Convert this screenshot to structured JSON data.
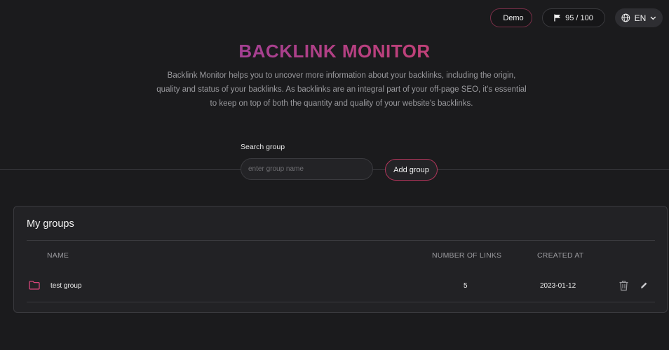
{
  "topbar": {
    "demo_label": "Demo",
    "quota_label": "95 / 100",
    "lang_label": "EN"
  },
  "header": {
    "title": "BACKLINK MONITOR",
    "description": "Backlink Monitor helps you to uncover more information about your backlinks, including the origin, quality and status of your backlinks. As backlinks are an integral part of your off-page SEO, it's essential to keep on top of both the quantity and quality of your website's backlinks."
  },
  "search": {
    "label": "Search group",
    "placeholder": "enter group name",
    "add_label": "Add group"
  },
  "groups": {
    "title": "My groups",
    "columns": [
      "NAME",
      "NUMBER OF LINKS",
      "CREATED AT"
    ],
    "rows": [
      {
        "name": "test group",
        "links": "5",
        "created": "2023-01-12"
      }
    ]
  },
  "colors": {
    "accent": "#e0455e",
    "accent_secondary": "#7d3fb8",
    "background": "#1b1b1d"
  }
}
